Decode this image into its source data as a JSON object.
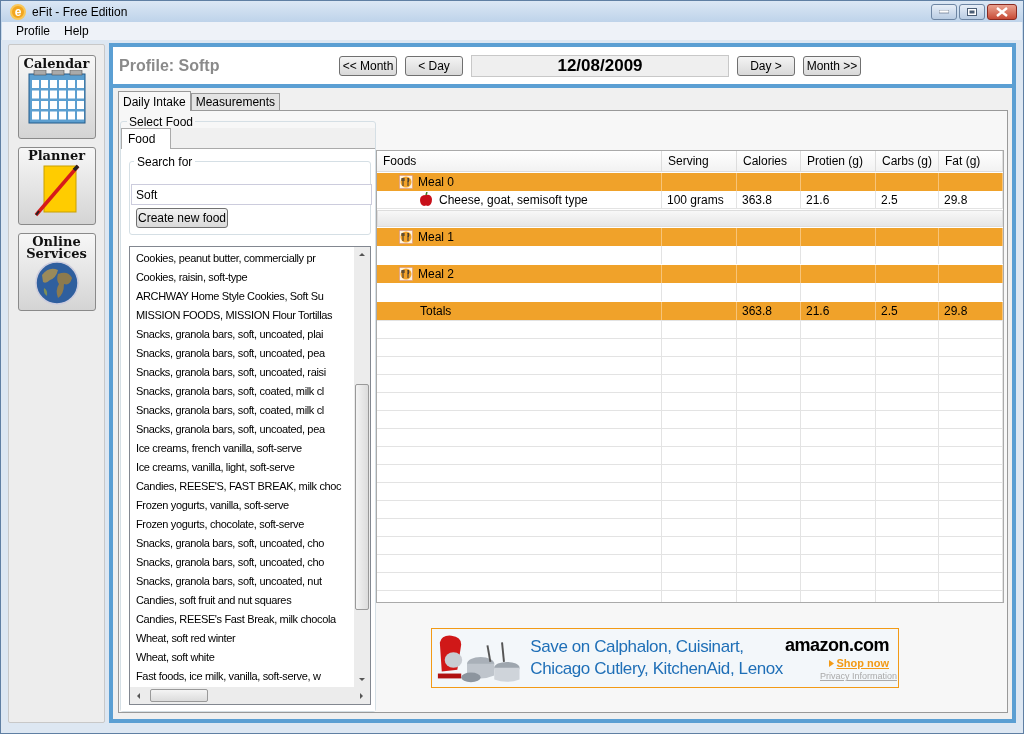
{
  "window": {
    "title": "eFit - Free Edition",
    "logo_letter": "e"
  },
  "menu": [
    "Profile",
    "Help"
  ],
  "sidebar": {
    "items": [
      {
        "label": "Calendar",
        "kind": "calendar"
      },
      {
        "label": "Planner",
        "kind": "planner"
      },
      {
        "label": "Online Services",
        "kind": "globe"
      }
    ]
  },
  "header": {
    "profile": "Profile: Softp",
    "date": "12/08/2009",
    "prev_buttons": [
      "<< Month",
      "< Day"
    ],
    "next_buttons": [
      "Day >",
      "Month >>"
    ]
  },
  "tabs": [
    {
      "label": "Daily Intake",
      "selected": true
    },
    {
      "label": "Measurements",
      "selected": false
    }
  ],
  "select_food": {
    "title": "Select Food",
    "tabs": [
      {
        "label": "Food",
        "selected": true
      }
    ],
    "search_label": "Search for",
    "search_value": "Soft",
    "create_button": "Create new food",
    "results": [
      "Cookies, peanut butter, commercially pr",
      "Cookies, raisin, soft-type",
      "ARCHWAY Home Style Cookies, Soft Su",
      "MISSION FOODS, MISSION Flour Tortillas",
      "Snacks, granola bars, soft, uncoated, plai",
      "Snacks, granola bars, soft, uncoated, pea",
      "Snacks, granola bars, soft, uncoated, raisi",
      "Snacks, granola bars, soft, coated, milk cl",
      "Snacks, granola bars, soft, coated, milk cl",
      "Snacks, granola bars, soft, uncoated, pea",
      "Ice creams, french vanilla, soft-serve",
      "Ice creams, vanilla, light, soft-serve",
      "Candies, REESE'S, FAST BREAK, milk choc",
      "Frozen yogurts, vanilla, soft-serve",
      "Frozen yogurts, chocolate, soft-serve",
      "Snacks, granola bars, soft, uncoated, cho",
      "Snacks, granola bars, soft, uncoated, cho",
      "Snacks, granola bars, soft, uncoated, nut",
      "Candies, soft fruit and nut squares",
      "Candies, REESE's Fast Break, milk chocola",
      "Wheat, soft red winter",
      "Wheat, soft white",
      "Fast foods, ice milk, vanilla, soft-serve, w"
    ]
  },
  "table": {
    "columns": [
      "Foods",
      "Serving",
      "Calories",
      "Protien (g)",
      "Carbs (g)",
      "Fat (g)"
    ],
    "rows": [
      {
        "kind": "meal",
        "cells": [
          "Meal 0"
        ]
      },
      {
        "kind": "food",
        "cells": [
          "Cheese, goat, semisoft type",
          "100 grams",
          "363.8",
          "21.6",
          "2.5",
          "29.8"
        ]
      },
      {
        "kind": "separator",
        "cells": []
      },
      {
        "kind": "meal",
        "cells": [
          "Meal 1"
        ]
      },
      {
        "kind": "blank",
        "cells": []
      },
      {
        "kind": "meal",
        "cells": [
          "Meal 2"
        ]
      },
      {
        "kind": "blank",
        "cells": []
      },
      {
        "kind": "total",
        "cells": [
          "Totals",
          "",
          "363.8",
          "21.6",
          "2.5",
          "29.8"
        ]
      }
    ]
  },
  "ad": {
    "headline": "Save on Calphalon, Cuisinart, Chicago Cutlery, KitchenAid, Lenox",
    "brand": "amazon.com",
    "cta": "Shop now",
    "privacy": "Privacy Information"
  }
}
